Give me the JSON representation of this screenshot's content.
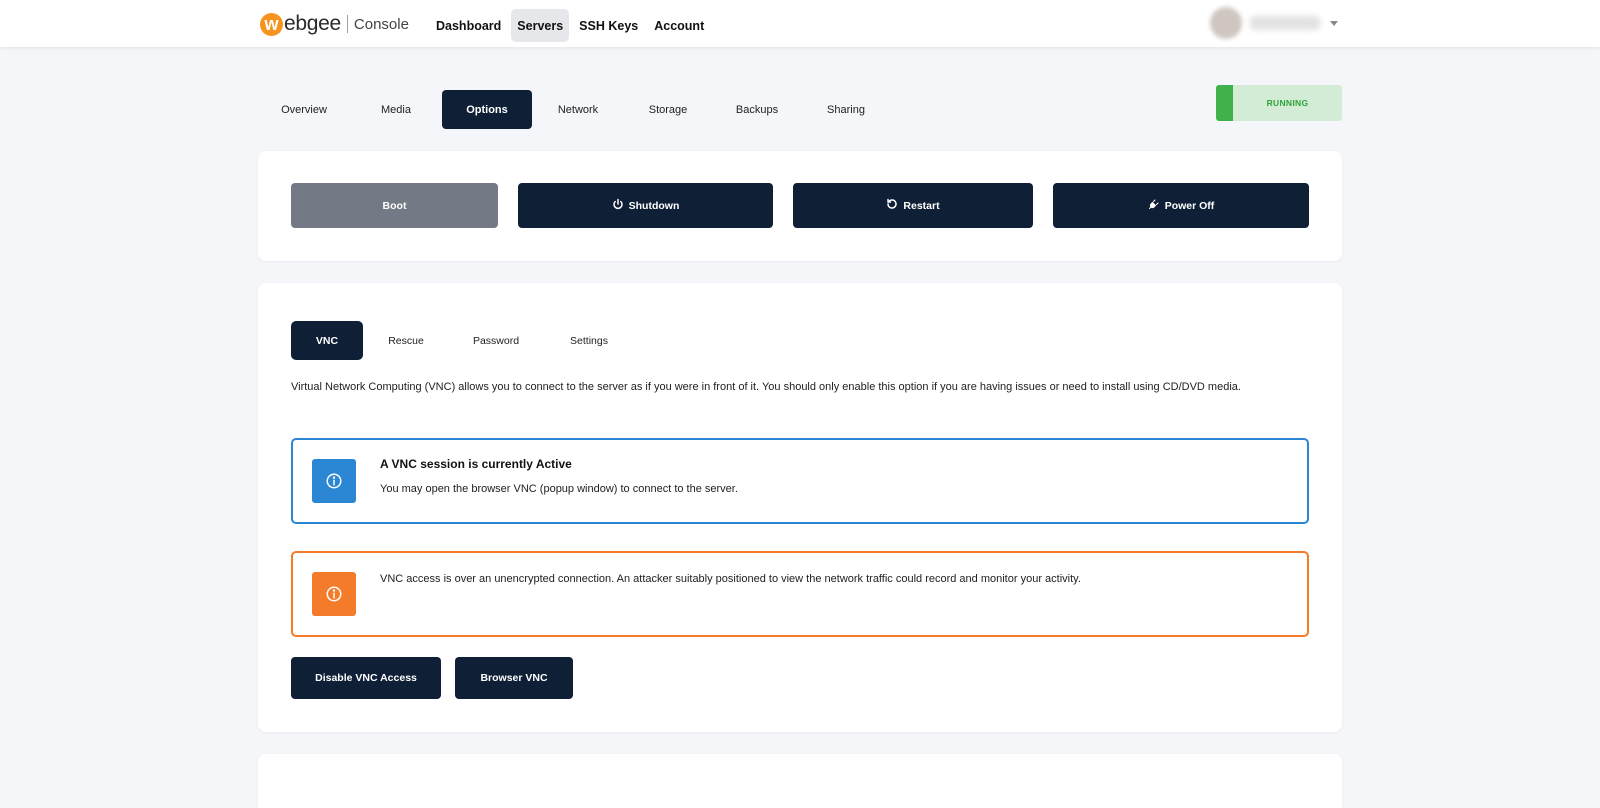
{
  "brand": {
    "logo_letter": "w",
    "logo_rest": "ebgee",
    "product": "Console"
  },
  "nav": {
    "items": [
      {
        "label": "Dashboard"
      },
      {
        "label": "Servers",
        "active": true
      },
      {
        "label": "SSH Keys"
      },
      {
        "label": "Account"
      }
    ]
  },
  "server_tabs": {
    "items": [
      "Overview",
      "Media",
      "Options",
      "Network",
      "Storage",
      "Backups",
      "Sharing"
    ],
    "active": "Options"
  },
  "status": {
    "label": "RUNNING",
    "color": "#41b24b"
  },
  "power": {
    "boot": "Boot",
    "shutdown": "Shutdown",
    "restart": "Restart",
    "power_off": "Power Off"
  },
  "options_tabs": {
    "items": [
      "VNC",
      "Rescue",
      "Password",
      "Settings"
    ],
    "active": "VNC"
  },
  "vnc": {
    "description": "Virtual Network Computing (VNC) allows you to connect to the server as if you were in front of it. You should only enable this option if you are having issues or need to install using CD/DVD media.",
    "info_title": "A VNC session is currently Active",
    "info_body": "You may open the browser VNC (popup window) to connect to the server.",
    "warning_body": "VNC access is over an unencrypted connection. An attacker suitably positioned to view the network traffic could record and monitor your activity.",
    "disable_button": "Disable VNC Access",
    "browser_button": "Browser VNC"
  },
  "colors": {
    "primary": "#0f1f36",
    "info": "#2b87d3",
    "warning": "#f47b2a",
    "accent": "#f7941d"
  },
  "icons": [
    "power-icon",
    "restart-icon",
    "plug-icon",
    "info-icon",
    "chevron-down-icon"
  ]
}
